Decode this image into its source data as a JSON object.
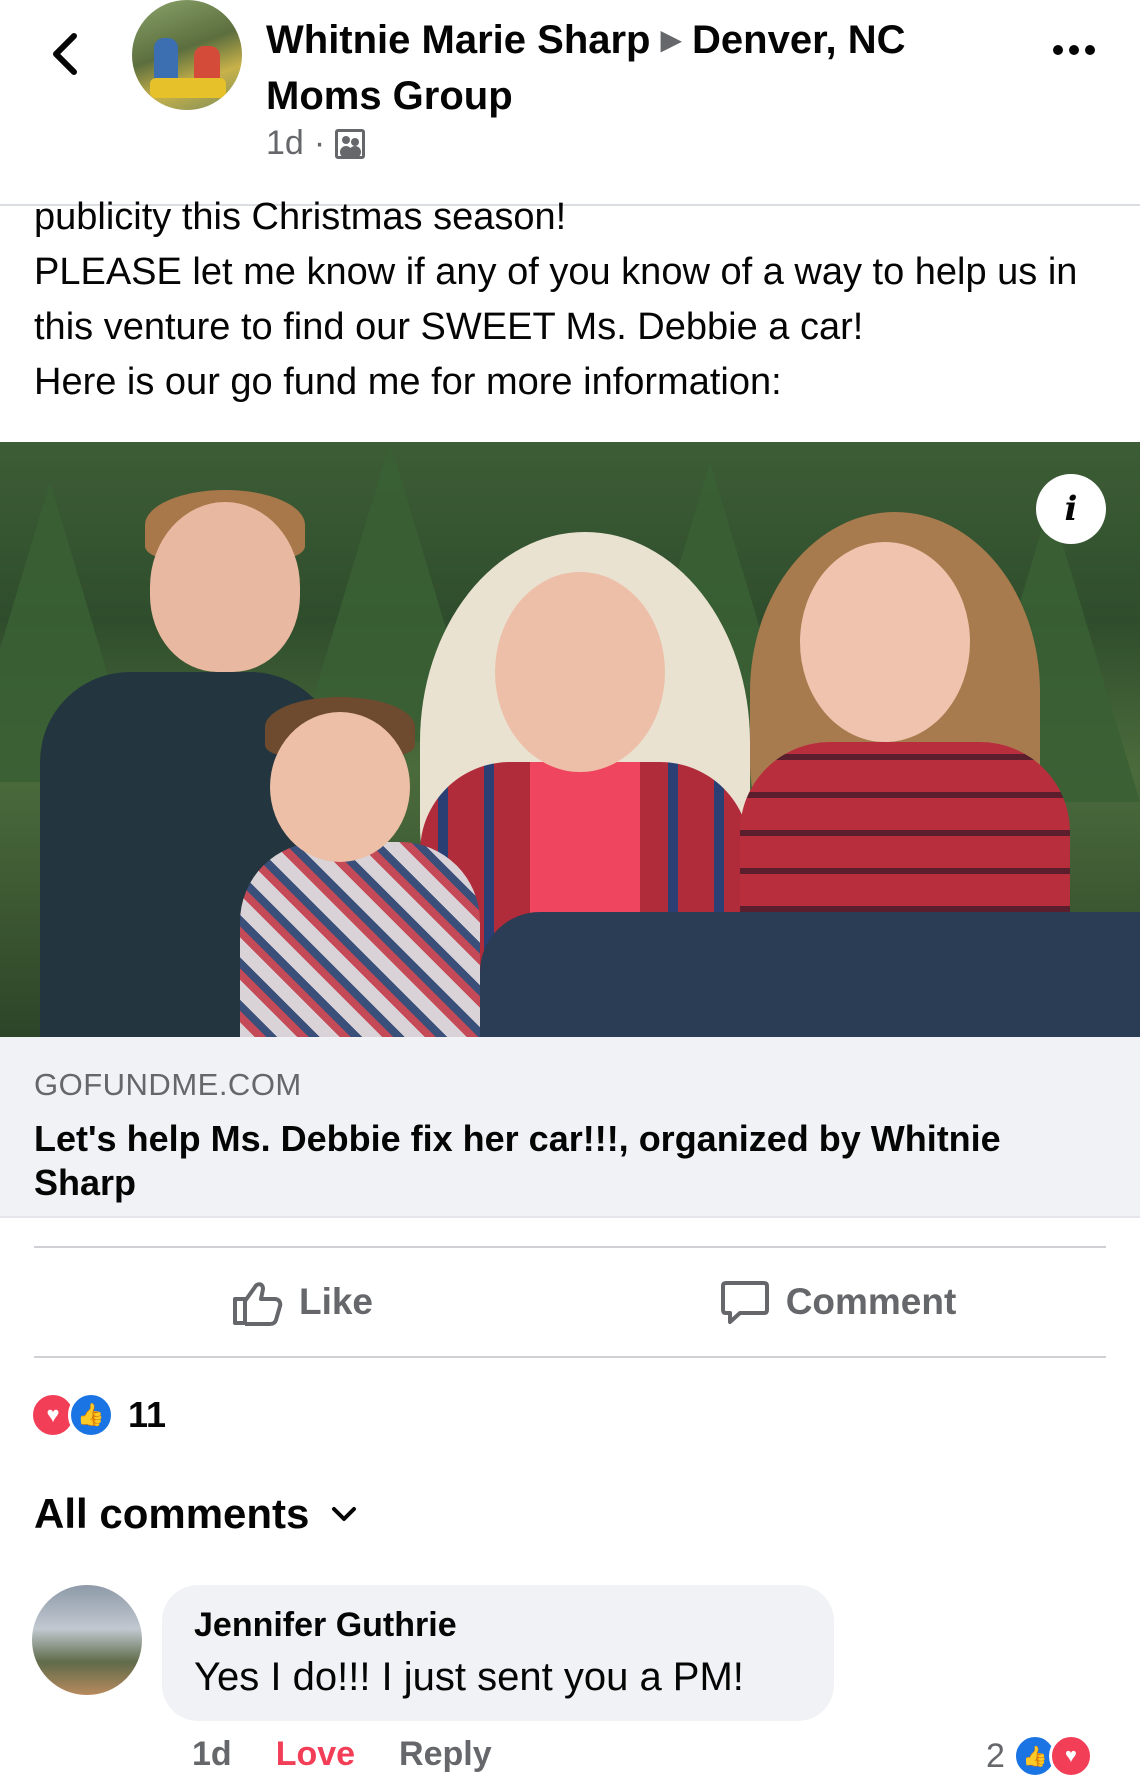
{
  "post": {
    "author": "Whitnie Marie Sharp",
    "group": "Denver, NC Moms Group",
    "time": "1d",
    "text_lines": [
      "publicity this Christmas season!",
      "PLEASE let me know if any of you know of a way to help us in this venture to find our SWEET Ms. Debbie a car!",
      "Here is our go fund me for more information:"
    ]
  },
  "link": {
    "domain": "GOFUNDME.COM",
    "title": "Let's help Ms. Debbie fix her car!!!, organized by Whitnie Sharp",
    "info_label": "i"
  },
  "actions": {
    "like": "Like",
    "comment": "Comment"
  },
  "reactions": {
    "count": "11",
    "types": [
      "love",
      "like"
    ]
  },
  "comments_header": "All comments",
  "comment": {
    "author": "Jennifer Guthrie",
    "text": "Yes I do!!! I just sent you a PM!",
    "time": "1d",
    "love_label": "Love",
    "reply_label": "Reply",
    "reaction_count": "2"
  },
  "colors": {
    "secondary_text": "#65676b",
    "like_blue": "#1b74e4",
    "love_red": "#f33e58",
    "caption_bg": "#f0f2f5"
  },
  "icons": [
    "back-arrow-icon",
    "group-privacy-icon",
    "more-icon",
    "info-icon",
    "like-thumb-icon",
    "comment-bubble-icon",
    "love-reaction-icon",
    "like-reaction-icon",
    "chevron-down-icon"
  ]
}
